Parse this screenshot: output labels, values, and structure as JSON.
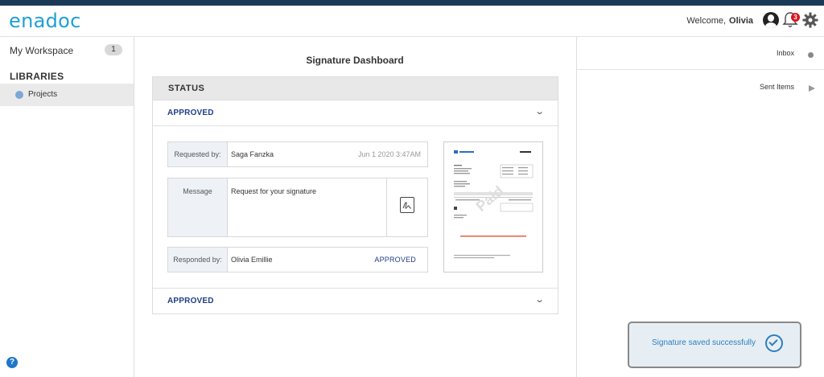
{
  "header": {
    "logo": "enadoc",
    "welcome_label": "Welcome,",
    "user_name": "Olivia",
    "notification_count": "3"
  },
  "sidebar": {
    "workspace_label": "My Workspace",
    "workspace_count": "1",
    "libraries_label": "LIBRARIES",
    "items": [
      {
        "label": "Projects"
      }
    ],
    "help_label": "?"
  },
  "main": {
    "title": "Signature Dashboard",
    "status_header": "STATUS",
    "accordions": [
      {
        "label": "APPROVED"
      },
      {
        "label": "APPROVED"
      }
    ],
    "details": {
      "requested_by_label": "Requested by:",
      "requested_by": "Saga Fanzka",
      "requested_date": "Jun 1 2020 3:47AM",
      "message_label": "Message",
      "message": "Request for your signature",
      "responded_by_label": "Responded by:",
      "responded_by": "Olivia Emillie",
      "response_status": "APPROVED"
    },
    "thumbnail": {
      "stamp": "Paid"
    }
  },
  "right_panel": {
    "items": [
      {
        "label": "Inbox"
      },
      {
        "label": "Sent Items"
      }
    ]
  },
  "toast": {
    "message": "Signature saved successfully"
  }
}
